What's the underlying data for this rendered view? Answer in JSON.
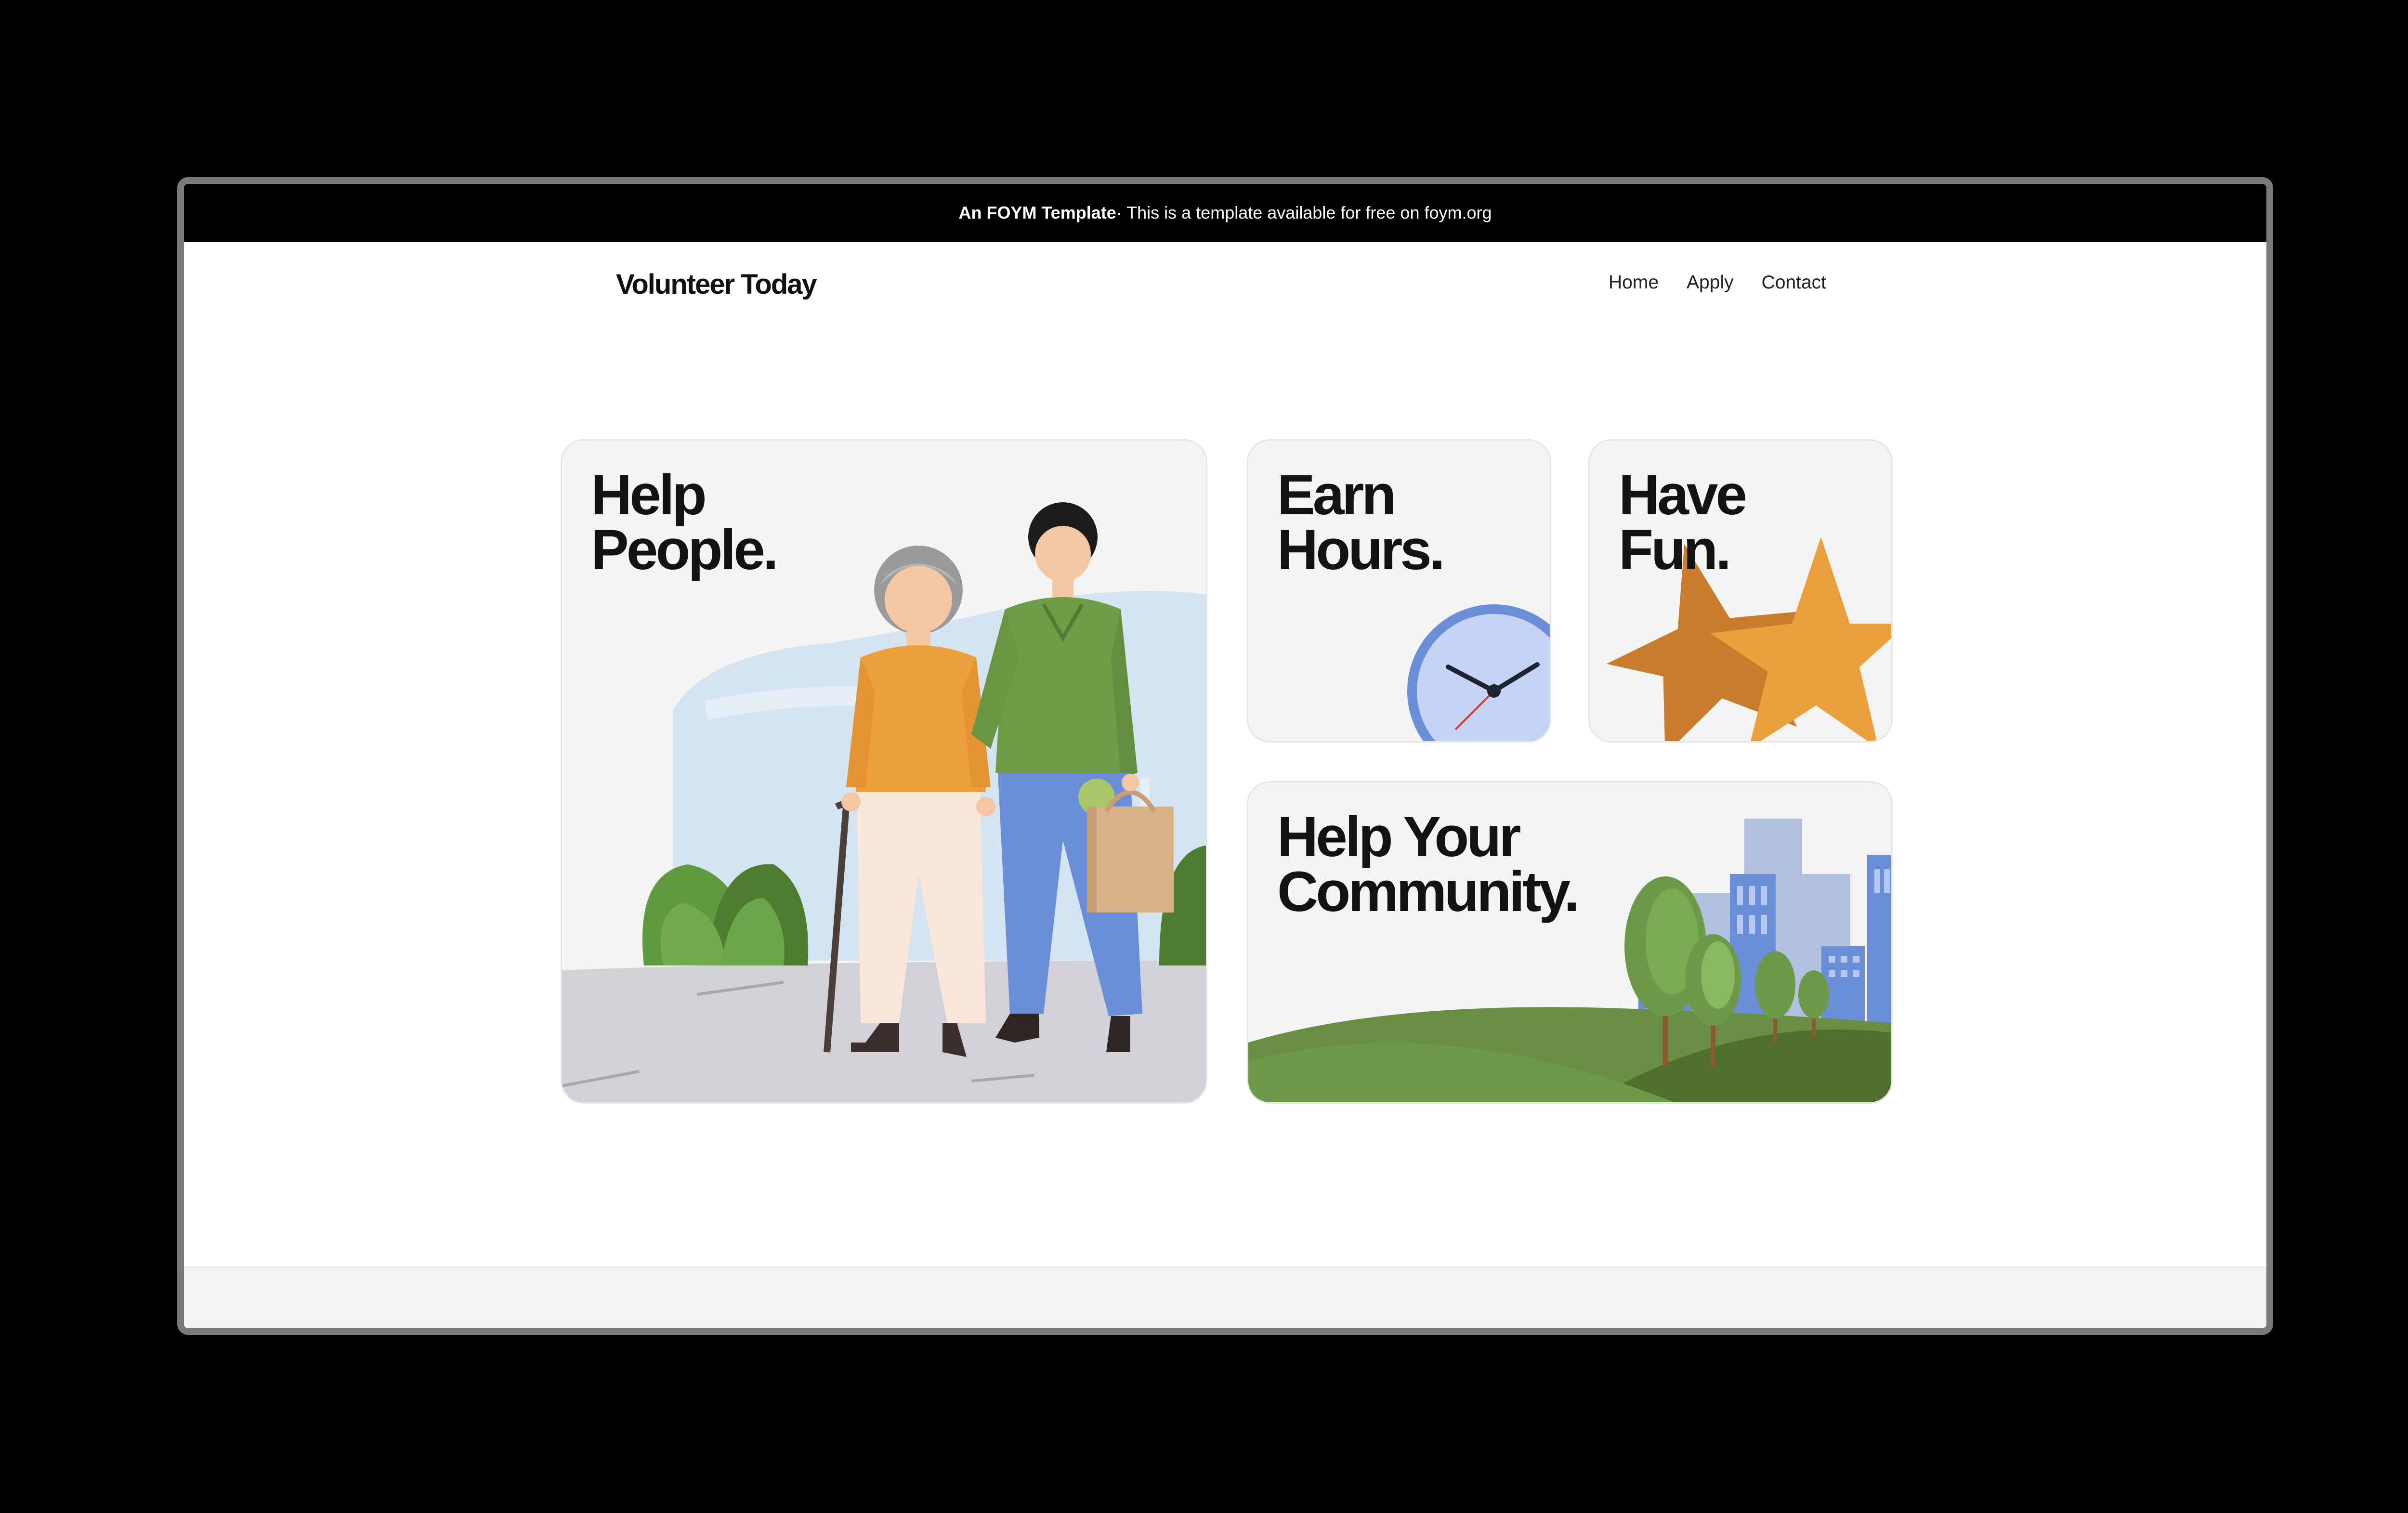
{
  "banner": {
    "bold_text": "An FOYM Template",
    "text": " · This is a template available for free on foym.org"
  },
  "header": {
    "brand": "Volunteer Today",
    "nav": [
      "Home",
      "Apply",
      "Contact"
    ]
  },
  "cards": {
    "help_people": {
      "line1": "Help",
      "line2": "People."
    },
    "earn_hours": {
      "line1": "Earn",
      "line2": "Hours."
    },
    "have_fun": {
      "line1": "Have",
      "line2": "Fun."
    },
    "community": {
      "line1": "Help Your",
      "line2": "Community."
    }
  },
  "colors": {
    "banner_bg": "#000000",
    "card_bg": "#f4f4f4",
    "accent_orange": "#eca03c",
    "accent_green": "#6c9a48",
    "accent_blue": "#6a8ed8"
  }
}
